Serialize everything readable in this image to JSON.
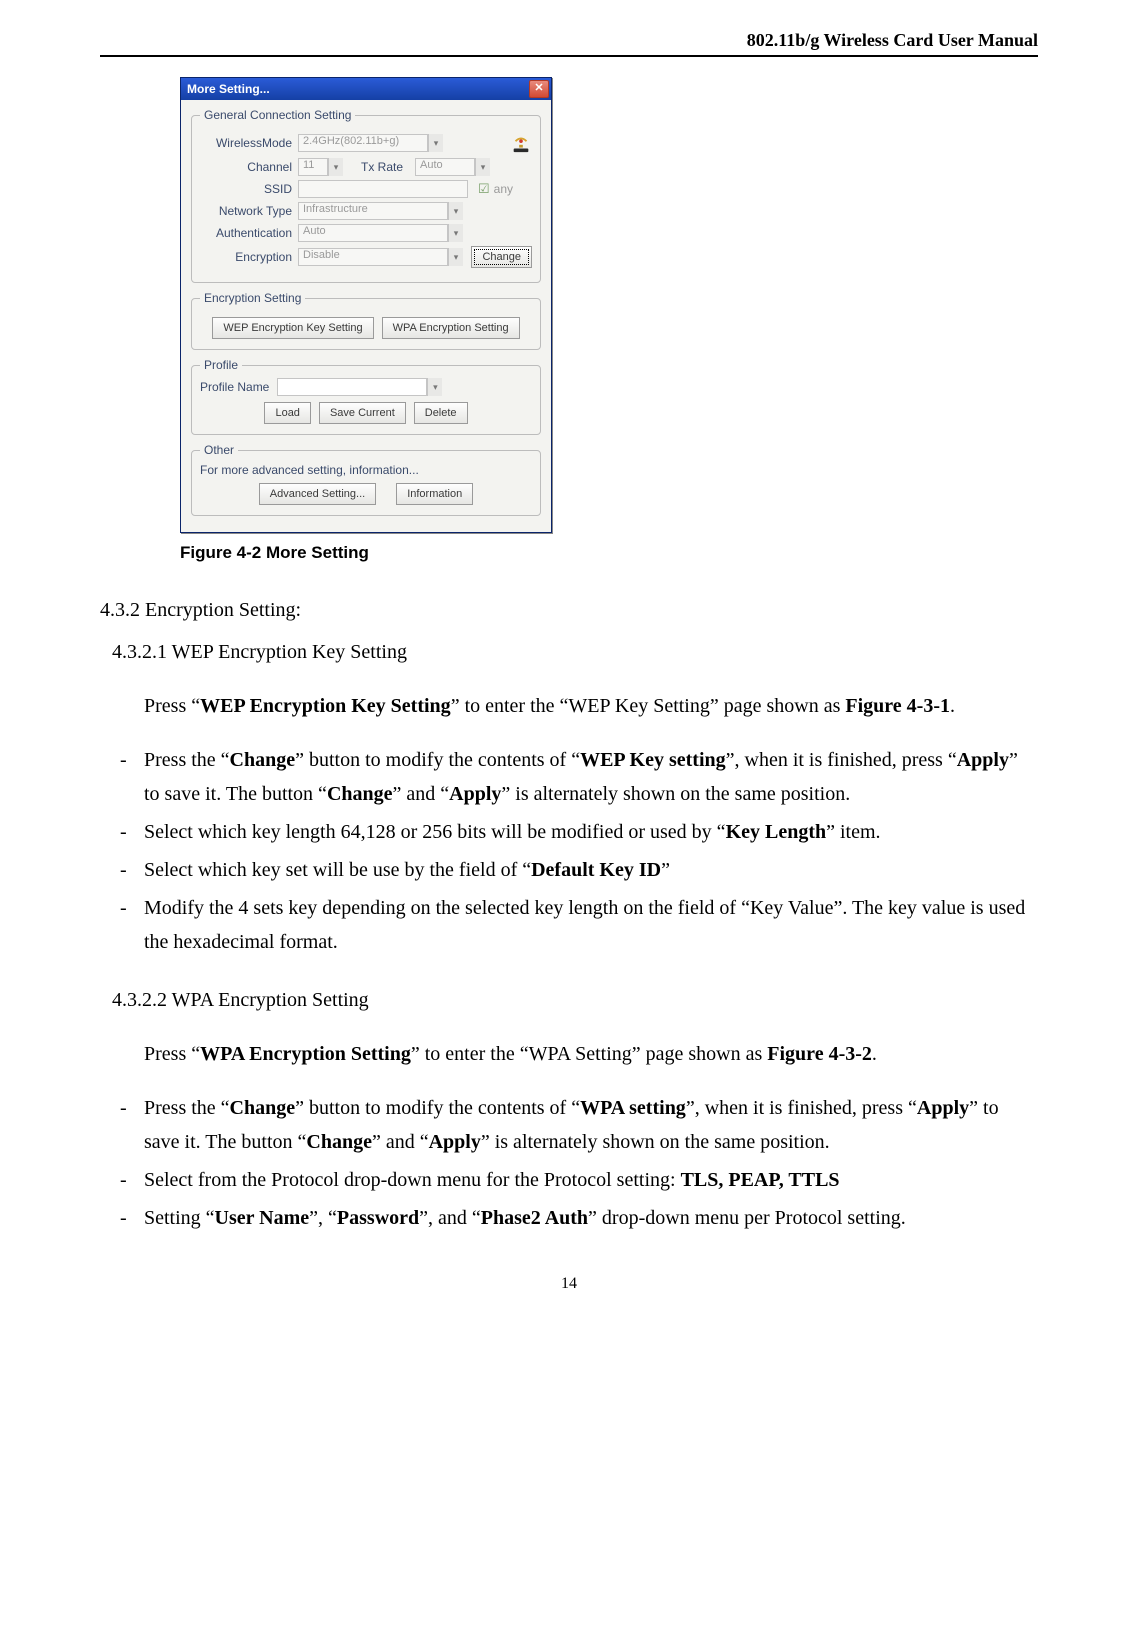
{
  "header": {
    "title": "802.11b/g Wireless Card User Manual"
  },
  "dialog": {
    "title": "More Setting...",
    "groups": {
      "general": {
        "legend": "General Connection Setting",
        "wirelessMode": {
          "label": "WirelessMode",
          "value": "2.4GHz(802.11b+g)"
        },
        "channel": {
          "label": "Channel",
          "value": "11"
        },
        "txRate": {
          "label": "Tx Rate",
          "value": "Auto"
        },
        "ssid": {
          "label": "SSID",
          "value": "",
          "anyLabel": "any",
          "anyChecked": true
        },
        "networkType": {
          "label": "Network Type",
          "value": "Infrastructure"
        },
        "authentication": {
          "label": "Authentication",
          "value": "Auto"
        },
        "encryption": {
          "label": "Encryption",
          "value": "Disable"
        },
        "changeBtn": "Change"
      },
      "encryption": {
        "legend": "Encryption Setting",
        "wepBtn": "WEP Encryption Key Setting",
        "wpaBtn": "WPA Encryption Setting"
      },
      "profile": {
        "legend": "Profile",
        "profileNameLabel": "Profile Name",
        "loadBtn": "Load",
        "saveBtn": "Save Current",
        "deleteBtn": "Delete"
      },
      "other": {
        "legend": "Other",
        "text": "For more advanced setting, information...",
        "advBtn": "Advanced Setting...",
        "infoBtn": "Information"
      }
    }
  },
  "figure": {
    "caption": "Figure 4-2 More Setting"
  },
  "text": {
    "s432": "4.3.2 Encryption Setting:",
    "s4321": "4.3.2.1 WEP Encryption Key Setting",
    "p1a": "Press “",
    "p1b": "WEP Encryption Key Setting",
    "p1c": "” to enter the “WEP Key Setting” page shown as ",
    "p1d": "Figure 4-3-1",
    "p1e": ".",
    "li1a": "Press the “",
    "li1b": "Change",
    "li1c": "” button to modify the contents of “",
    "li1d": "WEP Key setting",
    "li1e": "”, when it is finished, press “",
    "li1f": "Apply",
    "li1g": "” to save it. The button “",
    "li1h": "Change",
    "li1i": "” and “",
    "li1j": "Apply",
    "li1k": "” is alternately shown on the same position.",
    "li2a": "Select which key length 64,128 or 256 bits will be modified or used by “",
    "li2b": "Key Length",
    "li2c": "” item.",
    "li3a": "Select which key set will be use by the field of “",
    "li3b": "Default Key ID",
    "li3c": "”",
    "li4": "Modify the 4 sets key depending on the selected key length on the field of “Key Value”. The key value is used the hexadecimal format.",
    "s4322": "4.3.2.2 WPA Encryption Setting",
    "p2a": "Press “",
    "p2b": "WPA Encryption Setting",
    "p2c": "” to enter the “WPA Setting” page shown as ",
    "p2d": "Figure 4-3-2",
    "p2e": ".",
    "li5a": "Press the “",
    "li5b": "Change",
    "li5c": "” button to modify the contents of “",
    "li5d": "WPA setting",
    "li5e": "”, when it is finished, press “",
    "li5f": "Apply",
    "li5g": "” to save it. The button “",
    "li5h": "Change",
    "li5i": "” and “",
    "li5j": "Apply",
    "li5k": "” is alternately shown on the same position.",
    "li6a": "Select from the Protocol drop-down menu for the Protocol setting: ",
    "li6b": "TLS, PEAP, TTLS",
    "li7a": "Setting “",
    "li7b": "User Name",
    "li7c": "”, “",
    "li7d": "Password",
    "li7e": "”, and “",
    "li7f": "Phase2 Auth",
    "li7g": "” drop-down menu per Protocol setting."
  },
  "pageNumber": "14"
}
